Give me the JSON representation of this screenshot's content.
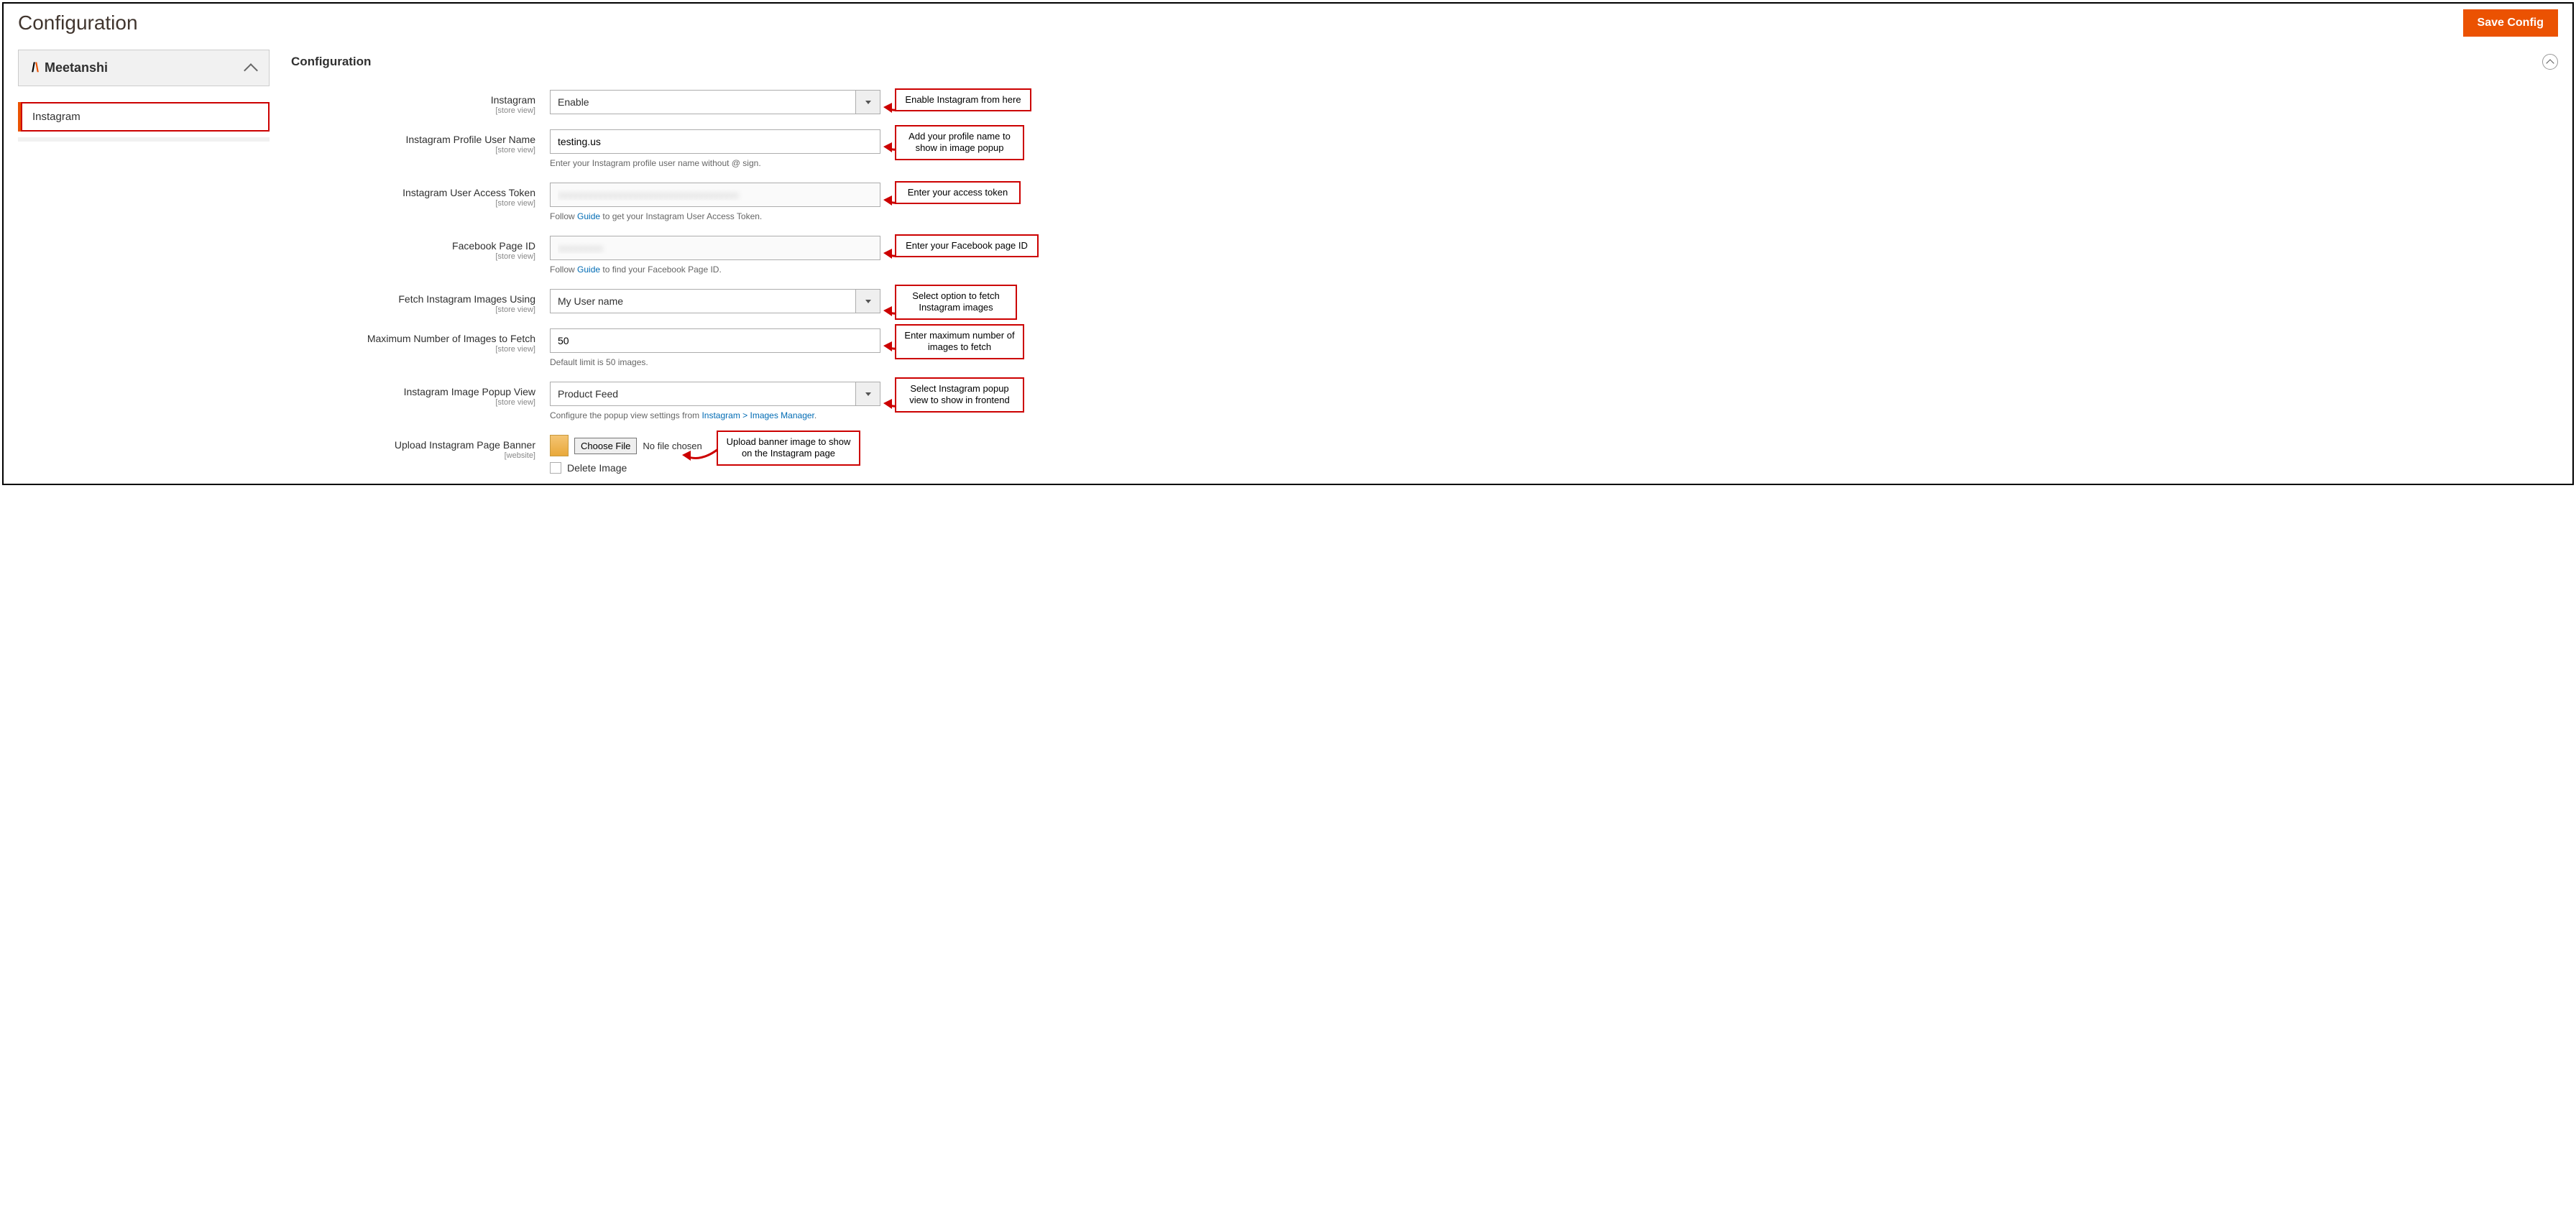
{
  "page": {
    "title": "Configuration",
    "save_label": "Save Config"
  },
  "sidebar": {
    "brand_name": "Meetanshi",
    "items": [
      {
        "label": "Instagram"
      }
    ]
  },
  "section": {
    "title": "Configuration"
  },
  "fields": {
    "instagram": {
      "label": "Instagram",
      "scope": "[store view]",
      "value": "Enable",
      "callout": "Enable Instagram from here"
    },
    "profile_user": {
      "label": "Instagram Profile User Name",
      "scope": "[store view]",
      "value": "testing.us",
      "help": "Enter your Instagram profile user name without @ sign.",
      "callout": "Add your profile name to show in image popup"
    },
    "access_token": {
      "label": "Instagram User Access Token",
      "scope": "[store view]",
      "help_pre": "Follow ",
      "guide": "Guide",
      "help_post": " to get your Instagram User Access Token.",
      "callout": "Enter your access token"
    },
    "fb_page_id": {
      "label": "Facebook Page ID",
      "scope": "[store view]",
      "help_pre": "Follow ",
      "guide": "Guide",
      "help_post": " to find your Facebook Page ID.",
      "callout": "Enter your Facebook page ID"
    },
    "fetch_using": {
      "label": "Fetch Instagram Images Using",
      "scope": "[store view]",
      "value": "My User name",
      "callout": "Select option to fetch Instagram images"
    },
    "max_images": {
      "label": "Maximum Number of Images to Fetch",
      "scope": "[store view]",
      "value": "50",
      "help": "Default limit is 50 images.",
      "callout": "Enter maximum number of images to fetch"
    },
    "popup_view": {
      "label": "Instagram Image Popup View",
      "scope": "[store view]",
      "value": "Product Feed",
      "help_pre": "Configure the popup view settings from ",
      "link": "Instagram > Images Manager",
      "help_post": ".",
      "callout": "Select Instagram popup view to show in frontend"
    },
    "banner": {
      "label": "Upload Instagram Page Banner",
      "scope": "[website]",
      "choose": "Choose File",
      "no_file": "No file chosen",
      "delete": "Delete Image",
      "callout": "Upload banner image to show on the Instagram page"
    }
  }
}
